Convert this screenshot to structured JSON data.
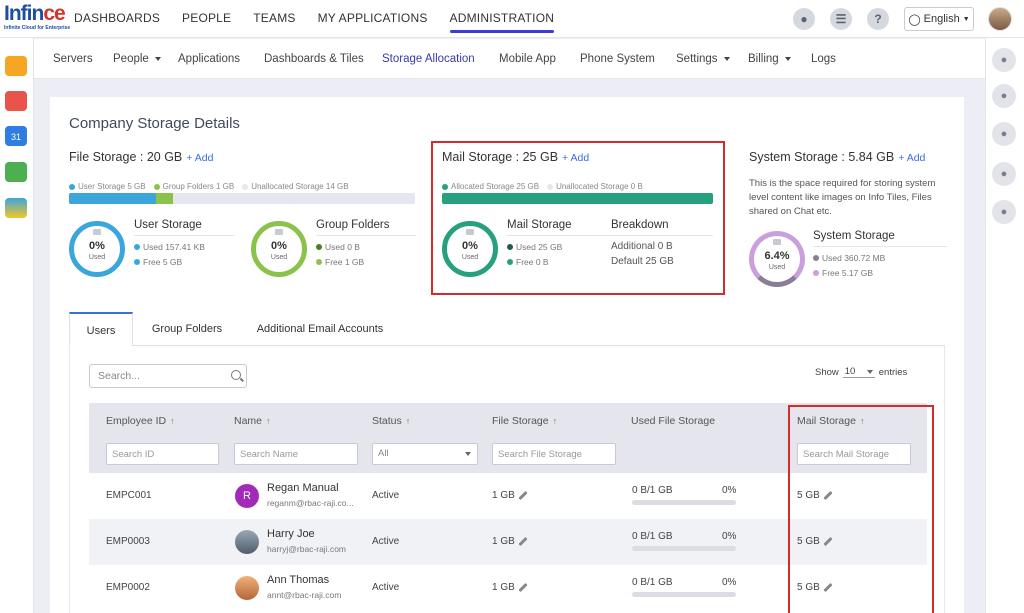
{
  "logo": {
    "brand_a": "Infin",
    "brand_b": "ce",
    "tagline": "Infinite Cloud for Enterprise"
  },
  "main_nav": [
    "DASHBOARDS",
    "PEOPLE",
    "TEAMS",
    "MY APPLICATIONS",
    "ADMINISTRATION"
  ],
  "main_nav_active": "ADMINISTRATION",
  "top_right": {
    "language": "English"
  },
  "sub_nav": [
    {
      "label": "Servers",
      "caret": false
    },
    {
      "label": "People",
      "caret": true
    },
    {
      "label": "Applications",
      "caret": false
    },
    {
      "label": "Dashboards & Tiles",
      "caret": false
    },
    {
      "label": "Storage Allocation",
      "caret": false,
      "active": true
    },
    {
      "label": "Mobile App",
      "caret": false
    },
    {
      "label": "Phone System",
      "caret": false
    },
    {
      "label": "Settings",
      "caret": true
    },
    {
      "label": "Billing",
      "caret": true
    },
    {
      "label": "Logs",
      "caret": false
    }
  ],
  "page": {
    "title": "Company Storage Details"
  },
  "file_storage": {
    "title": "File Storage : 20 GB",
    "add_label": "+ Add",
    "legend": [
      "User Storage 5 GB",
      "Group Folders 1 GB",
      "Unallocated Storage 14 GB"
    ],
    "user_fraction": 0.25,
    "group_fraction": 0.05,
    "user": {
      "title": "User Storage",
      "pct": "0%",
      "used_label": "Used",
      "used": "Used 157.41 KB",
      "free": "Free 5 GB"
    },
    "group": {
      "title": "Group Folders",
      "pct": "0%",
      "used_label": "Used",
      "used": "Used 0 B",
      "free": "Free 1 GB"
    }
  },
  "mail_storage": {
    "title": "Mail Storage : 25 GB",
    "add_label": "+ Add",
    "legend": [
      "Allocated Storage 25 GB",
      "Unallocated Storage 0 B"
    ],
    "allocated_fraction": 1.0,
    "mail": {
      "title": "Mail Storage",
      "pct": "0%",
      "used_label": "Used",
      "used": "Used 25 GB",
      "free": "Free 0 B"
    },
    "breakdown": {
      "title": "Breakdown",
      "additional": "Additional 0 B",
      "default": "Default 25 GB"
    }
  },
  "system_storage": {
    "title": "System Storage : 5.84 GB",
    "add_label": "+ Add",
    "description": "This is the space required for storing system level content like images on Info Tiles, Files shared on Chat etc.",
    "sub_title": "System Storage",
    "pct": "6.4%",
    "used_label": "Used",
    "used": "Used 360.72 MB",
    "free": "Free 5.17 GB"
  },
  "tabs": [
    "Users",
    "Group Folders",
    "Additional Email Accounts"
  ],
  "table": {
    "search_placeholder": "Search...",
    "show_label": "Show",
    "show_value": "10",
    "entries_label": "entries",
    "columns": [
      "Employee ID",
      "Name",
      "Status",
      "File Storage",
      "Used File Storage",
      "Mail Storage"
    ],
    "filters": {
      "id": "Search ID",
      "name": "Search Name",
      "status": "All",
      "file": "Search File Storage",
      "mail": "Search Mail Storage"
    },
    "rows": [
      {
        "id": "EMPC001",
        "name": "Regan Manual",
        "email": "reganm@rbac-raji.co...",
        "initial": "R",
        "status": "Active",
        "file": "1 GB",
        "used_file": "0 B/1 GB",
        "used_pct": "0%",
        "mail": "5 GB"
      },
      {
        "id": "EMP0003",
        "name": "Harry Joe",
        "email": "harryj@rbac-raji.com",
        "initial": "",
        "status": "Active",
        "file": "1 GB",
        "used_file": "0 B/1 GB",
        "used_pct": "0%",
        "mail": "5 GB"
      },
      {
        "id": "EMP0002",
        "name": "Ann Thomas",
        "email": "annt@rbac-raji.com",
        "initial": "",
        "status": "Active",
        "file": "1 GB",
        "used_file": "0 B/1 GB",
        "used_pct": "0%",
        "mail": "5 GB"
      }
    ]
  },
  "colors": {
    "accent": "#3c3ad8",
    "user_storage": "#3aa6dc",
    "group_folders": "#8bc34a",
    "mail": "#26a07f",
    "system": "#c9a0dc",
    "highlight": "#d42b2b"
  }
}
